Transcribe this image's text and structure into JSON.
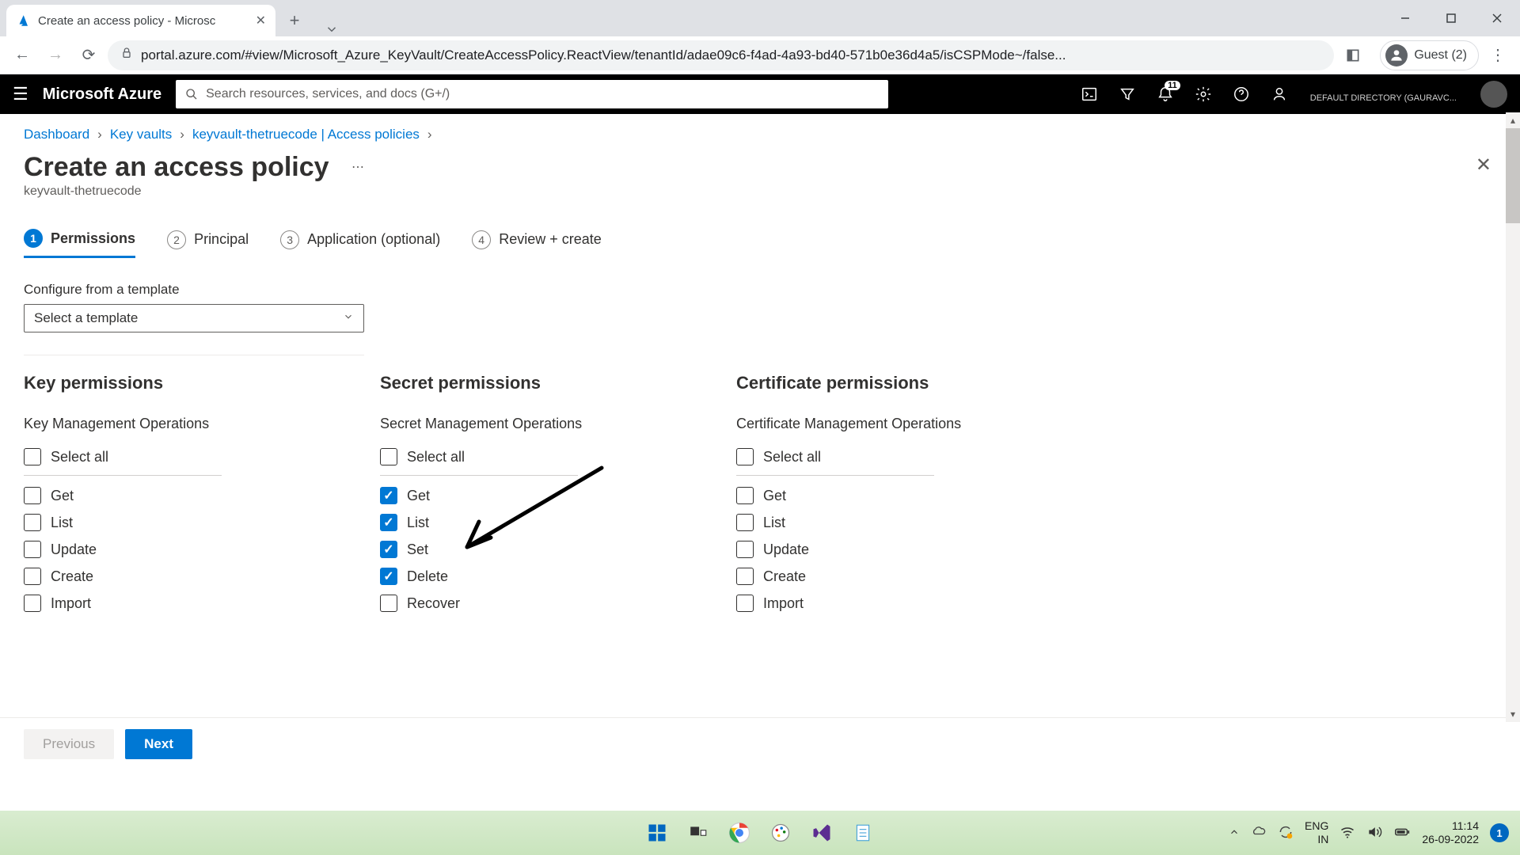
{
  "browser": {
    "tab_title": "Create an access policy - Microsc",
    "url": "portal.azure.com/#view/Microsoft_Azure_KeyVault/CreateAccessPolicy.ReactView/tenantId/adae09c6-f4ad-4a93-bd40-571b0e36d4a5/isCSPMode~/false...",
    "guest_label": "Guest (2)"
  },
  "azure_header": {
    "brand": "Microsoft Azure",
    "search_placeholder": "Search resources, services, and docs (G+/)",
    "notification_count": "11",
    "directory": "DEFAULT DIRECTORY (GAURAVC..."
  },
  "breadcrumb": {
    "items": [
      "Dashboard",
      "Key vaults",
      "keyvault-thetruecode | Access policies"
    ]
  },
  "page": {
    "title": "Create an access policy",
    "subtitle": "keyvault-thetruecode"
  },
  "wizard": {
    "tabs": [
      {
        "num": "1",
        "label": "Permissions",
        "active": true
      },
      {
        "num": "2",
        "label": "Principal",
        "active": false
      },
      {
        "num": "3",
        "label": "Application (optional)",
        "active": false
      },
      {
        "num": "4",
        "label": "Review + create",
        "active": false
      }
    ]
  },
  "template": {
    "label": "Configure from a template",
    "placeholder": "Select a template"
  },
  "permissions": {
    "select_all": "Select all",
    "columns": [
      {
        "title": "Key permissions",
        "subtitle": "Key Management Operations",
        "items": [
          {
            "label": "Get",
            "checked": false
          },
          {
            "label": "List",
            "checked": false
          },
          {
            "label": "Update",
            "checked": false
          },
          {
            "label": "Create",
            "checked": false
          },
          {
            "label": "Import",
            "checked": false
          }
        ]
      },
      {
        "title": "Secret permissions",
        "subtitle": "Secret Management Operations",
        "items": [
          {
            "label": "Get",
            "checked": true
          },
          {
            "label": "List",
            "checked": true
          },
          {
            "label": "Set",
            "checked": true
          },
          {
            "label": "Delete",
            "checked": true
          },
          {
            "label": "Recover",
            "checked": false
          }
        ]
      },
      {
        "title": "Certificate permissions",
        "subtitle": "Certificate Management Operations",
        "items": [
          {
            "label": "Get",
            "checked": false
          },
          {
            "label": "List",
            "checked": false
          },
          {
            "label": "Update",
            "checked": false
          },
          {
            "label": "Create",
            "checked": false
          },
          {
            "label": "Import",
            "checked": false
          }
        ]
      }
    ]
  },
  "footer": {
    "previous": "Previous",
    "next": "Next"
  },
  "taskbar": {
    "lang1": "ENG",
    "lang2": "IN",
    "time": "11:14",
    "date": "26-09-2022",
    "notif": "1"
  }
}
